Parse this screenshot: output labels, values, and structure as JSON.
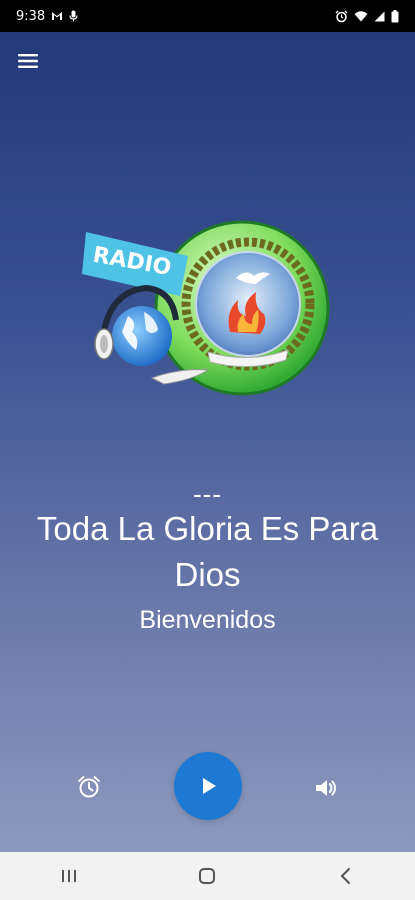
{
  "status_bar": {
    "time": "9:38",
    "left_icons": [
      "gmail-icon",
      "mic-notification-icon"
    ],
    "right_icons": [
      "alarm-icon",
      "wifi-icon",
      "signal-icon",
      "battery-icon"
    ]
  },
  "app": {
    "menu_icon": "hamburger-menu-icon",
    "logo": {
      "banner_text": "RADIO",
      "name": "radio-logo"
    },
    "now_playing": "---",
    "station_title": "Toda La Gloria Es Para Dios",
    "subtitle": "Bienvenidos"
  },
  "controls": {
    "alarm_icon": "alarm-clock-icon",
    "play_icon": "play-icon",
    "volume_icon": "volume-icon",
    "play_button_color": "#1e79d2"
  },
  "nav_bar": {
    "buttons": [
      "recent-apps-icon",
      "home-icon",
      "back-icon"
    ]
  },
  "colors": {
    "gradient_top": "#243a78",
    "gradient_bottom": "#8d99bd",
    "status_bar_bg": "#000000",
    "nav_bar_bg": "#f2f2f2"
  }
}
